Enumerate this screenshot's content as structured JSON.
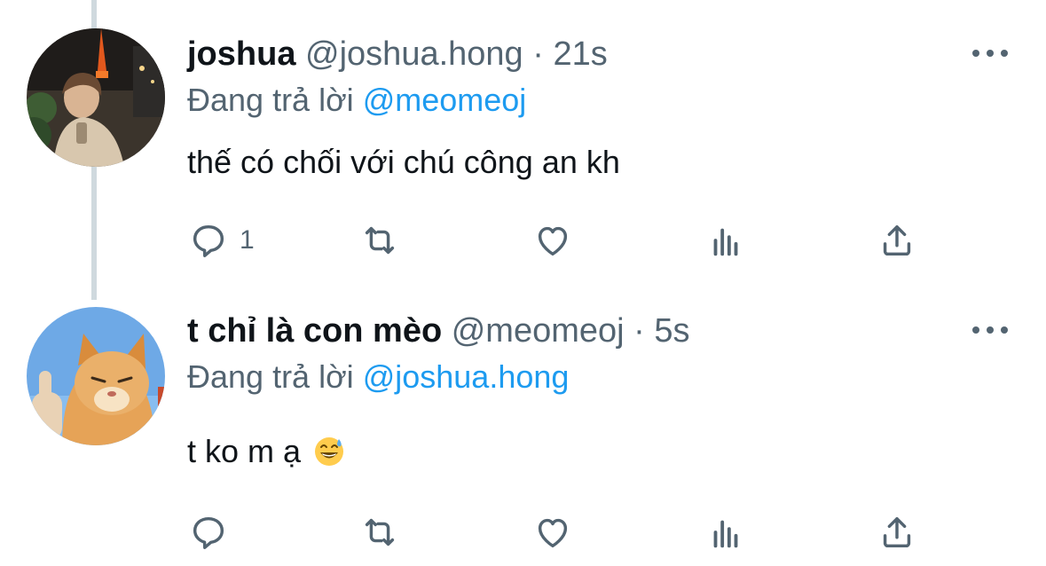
{
  "colors": {
    "text": "#0f1419",
    "secondary": "#536471",
    "link": "#1d9bf0",
    "thread_line": "#cfd9de",
    "background": "#ffffff"
  },
  "reply_prefix": "Đang trả lời",
  "tweets": [
    {
      "display_name": "joshua",
      "handle": "@joshua.hong",
      "separator": "·",
      "time": "21s",
      "reply_to": "@meomeoj",
      "text": "thế có chối với chú công an kh",
      "reply_count": "1",
      "avatar": "photo-person-tokyo-tower",
      "icons": [
        "reply-icon",
        "retweet-icon",
        "like-icon",
        "views-icon",
        "share-icon",
        "more-icon"
      ]
    },
    {
      "display_name": "t chỉ là con mèo",
      "handle": "@meomeoj",
      "separator": "·",
      "time": "5s",
      "reply_to": "@joshua.hong",
      "text": "t ko m ạ",
      "emoji": "grinning-sweat-emoji",
      "reply_count": "",
      "avatar": "photo-cat-thumbs-up",
      "icons": [
        "reply-icon",
        "retweet-icon",
        "like-icon",
        "views-icon",
        "share-icon",
        "more-icon"
      ]
    }
  ]
}
